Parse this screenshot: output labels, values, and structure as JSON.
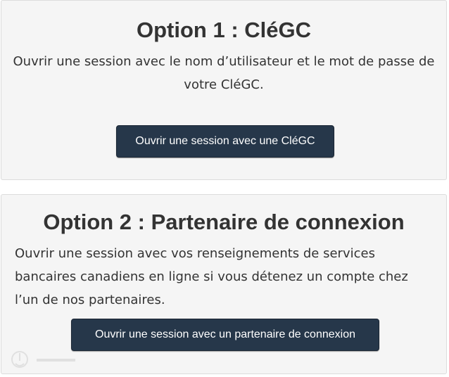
{
  "option1": {
    "title": "Option 1 : CléGC",
    "description": "Ouvrir une session avec le nom d’utilisateur et le mot de passe de votre CléGC.",
    "button_label": "Ouvrir une session avec une CléGC"
  },
  "option2": {
    "title": "Option 2 : Partenaire de connexion",
    "description": "Ouvrir une session avec vos renseignements de services bancaires canadiens en ligne si vous détenez un compte chez l’un de nos partenaires.",
    "button_label": "Ouvrir une session avec un partenaire de connexion"
  },
  "colors": {
    "panel_background": "#f5f5f5",
    "button_background": "#26374a",
    "text": "#333333"
  }
}
